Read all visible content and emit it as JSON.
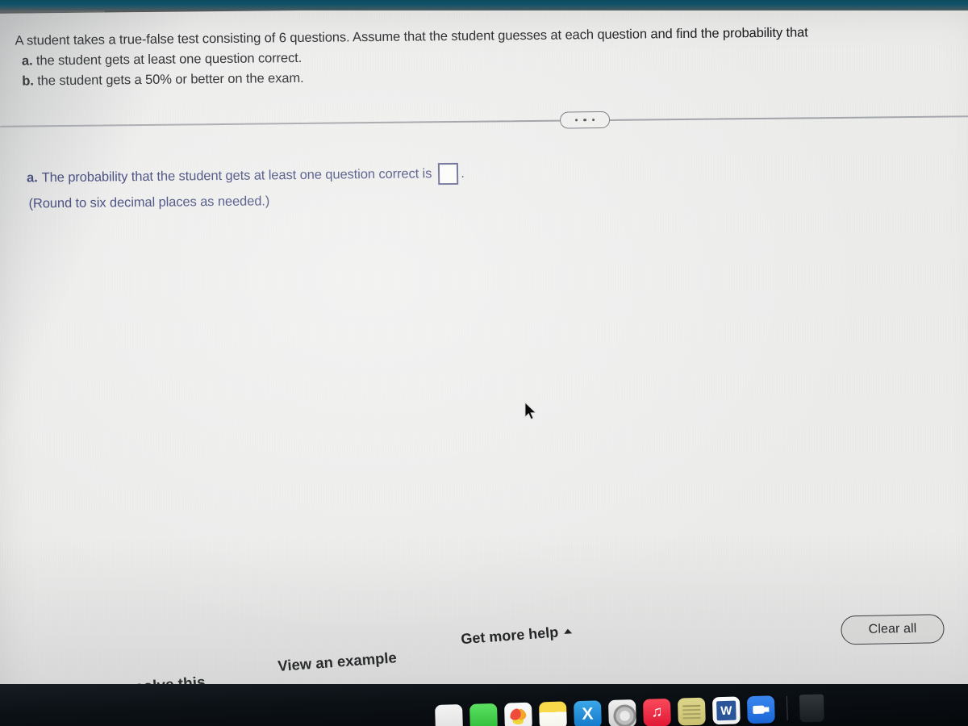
{
  "problem": {
    "stem": "A student takes a true-false test consisting of 6 questions. Assume that the student guesses at each question and find the probability that",
    "parts": [
      {
        "label": "a.",
        "text": "the student gets at least one question correct."
      },
      {
        "label": "b.",
        "text": "the student gets a 50% or better on the exam."
      }
    ]
  },
  "divider": {
    "handle_label": "more-options"
  },
  "answer": {
    "label": "a.",
    "prompt": "The probability that the student gets at least one question correct is",
    "input_value": "",
    "input_placeholder": "",
    "trailing_period": ".",
    "note": "(Round to six decimal places as needed.)"
  },
  "buttons": {
    "clear_all": "Clear all",
    "help_me_solve": "Help me solve this",
    "view_example": "View an example",
    "get_more_help": "Get more help"
  },
  "dock": {
    "items": [
      {
        "name": "finder",
        "label": "Finder"
      },
      {
        "name": "messages",
        "label": "Messages"
      },
      {
        "name": "photos",
        "label": "Photos"
      },
      {
        "name": "notes",
        "label": "Notes"
      },
      {
        "name": "xcode",
        "label": "X"
      },
      {
        "name": "system-preferences",
        "label": "System Preferences"
      },
      {
        "name": "music",
        "label": "Music"
      },
      {
        "name": "stickies",
        "label": "Stickies"
      },
      {
        "name": "word",
        "label": "W"
      },
      {
        "name": "zoom",
        "label": "Zoom"
      },
      {
        "name": "trash",
        "label": "Trash"
      }
    ]
  },
  "colors": {
    "answer_text": "#28306b",
    "problem_text": "#17181a",
    "screen_bg": "#ececeb",
    "top_strip": "#0d4a60",
    "dock_bg": "#0c1116"
  }
}
